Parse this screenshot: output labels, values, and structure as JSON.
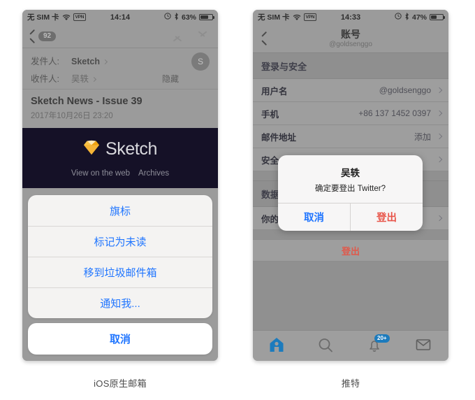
{
  "page": {
    "caption_left": "iOS原生邮箱",
    "caption_right": "推特"
  },
  "left_phone": {
    "status_bar": {
      "carrier": "无 SIM 卡",
      "wifi_icon": "wifi-icon",
      "vpn_label": "VPN",
      "time": "14:14",
      "alarm_icon": "alarm-icon",
      "bluetooth_icon": "bluetooth-icon",
      "battery_percent": "63%",
      "battery_icon": "battery-icon"
    },
    "navbar": {
      "back_icon": "chevron-left-icon",
      "unread_badge": "92",
      "up_icon": "chevron-up-icon",
      "down_icon": "chevron-down-icon"
    },
    "message_header": {
      "from_label": "发件人:",
      "from_value": "Sketch",
      "to_label": "收件人:",
      "to_value": "吴轶",
      "hide_label": "隐藏",
      "avatar_initial": "S"
    },
    "subject_block": {
      "subject": "Sketch News - Issue 39",
      "date": "2017年10月26日 23:20"
    },
    "banner": {
      "logo_icon": "sketch-diamond-icon",
      "brand": "Sketch",
      "links": [
        "View on the web",
        "Archives"
      ],
      "background_color": "#151127"
    },
    "action_sheet": {
      "items": [
        {
          "label": "旗标",
          "style": "default"
        },
        {
          "label": "标记为未读",
          "style": "default"
        },
        {
          "label": "移到垃圾邮件箱",
          "style": "default"
        },
        {
          "label": "通知我...",
          "style": "default"
        }
      ],
      "cancel_label": "取消",
      "tint_color": "#2176ff"
    }
  },
  "right_phone": {
    "status_bar": {
      "carrier": "无 SIM 卡",
      "wifi_icon": "wifi-icon",
      "vpn_label": "VPN",
      "time": "14:33",
      "alarm_icon": "alarm-icon",
      "bluetooth_icon": "bluetooth-icon",
      "battery_percent": "47%",
      "battery_icon": "battery-icon"
    },
    "navbar": {
      "back_icon": "chevron-left-icon",
      "title": "账号",
      "subtitle": "@goldsenggo"
    },
    "section_header": "登录与安全",
    "rows": [
      {
        "label": "用户名",
        "value": "@goldsenggo"
      },
      {
        "label": "手机",
        "value": "+86 137 1452 0397"
      },
      {
        "label": "邮件地址",
        "value": "添加"
      },
      {
        "label": "安全",
        "value": ""
      }
    ],
    "section_header_2": "数据与权限",
    "rows_2": [
      {
        "label": "你的 Twitter 数据",
        "value": ""
      }
    ],
    "logout_label": "登出",
    "alert": {
      "title": "吴轶",
      "message": "确定要登出 Twitter?",
      "cancel_label": "取消",
      "confirm_label": "登出",
      "cancel_color": "#2176ff",
      "confirm_color": "#e8554a"
    },
    "tabbar": {
      "items": [
        {
          "icon": "home-icon",
          "label": "",
          "active": true,
          "badge": ""
        },
        {
          "icon": "search-icon",
          "label": "",
          "active": false,
          "badge": ""
        },
        {
          "icon": "bell-icon",
          "label": "",
          "active": false,
          "badge": "20+"
        },
        {
          "icon": "mail-icon",
          "label": "",
          "active": false,
          "badge": ""
        }
      ],
      "active_color": "#1c7bbd"
    }
  }
}
